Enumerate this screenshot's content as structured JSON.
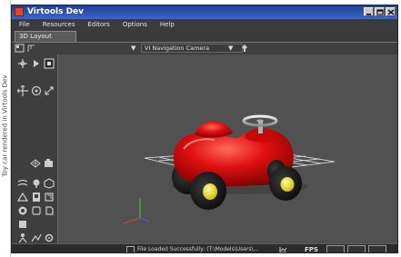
{
  "side_caption": {
    "text": "Toy car rendered in Virtools Dev"
  },
  "window": {
    "title": "Virtools Dev",
    "controls": [
      "minimize-icon",
      "maximize-icon",
      "close-icon"
    ]
  },
  "menu": {
    "items": [
      "File",
      "Resources",
      "Editors",
      "Options",
      "Help"
    ]
  },
  "tabs": [
    {
      "label": "3D Layout"
    }
  ],
  "toolbar": {
    "camera_select": "VI Navigation Camera",
    "icons": [
      "layout-icon",
      "grid-icon",
      "dropdown-arrow-icon",
      "camera-dropdown-arrow-icon",
      "pin-icon"
    ]
  },
  "left_panel": {
    "tools": [
      "select-icon",
      "move-icon",
      "rotate-icon",
      "scale-icon",
      "orbit-icon",
      "zoom-icon",
      "light-icon",
      "camera-icon",
      "mesh-icon",
      "material-icon",
      "texture-icon",
      "sprite-icon",
      "frame-icon",
      "grid-icon",
      "snap-icon",
      "portal-icon"
    ]
  },
  "status": {
    "message": "File Loaded Successfully: (T:\\Models\\Users\\...",
    "fps_label": "FPS",
    "playback": [
      "rewind-button",
      "play-button",
      "step-button"
    ]
  },
  "colors": {
    "title_bar": "#2a52b8",
    "viewport_bg": "#515151",
    "car_body": "#e01010",
    "wheel_hub": "#e8e020"
  }
}
